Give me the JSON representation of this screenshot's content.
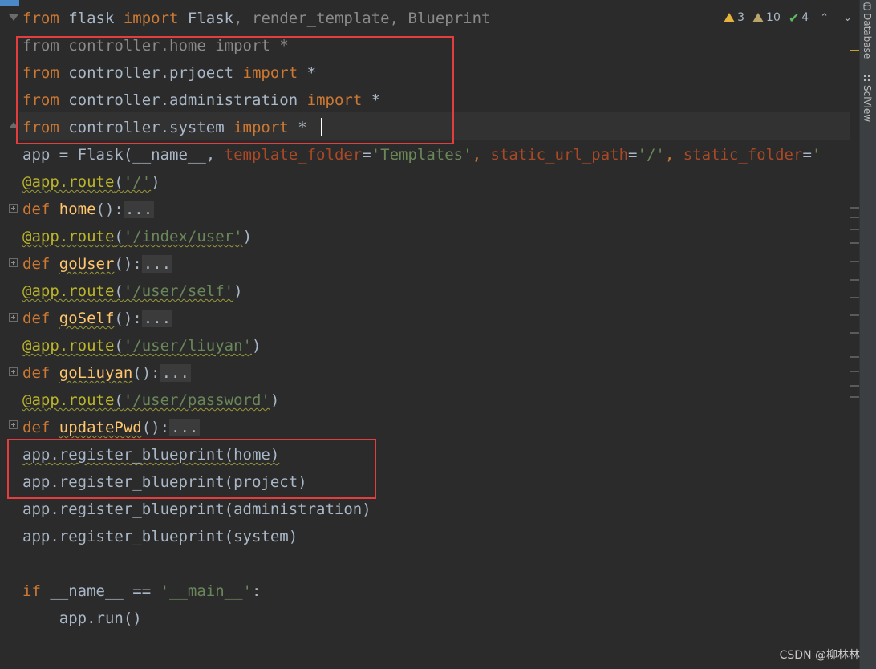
{
  "code": {
    "l1": {
      "kw1": "from",
      "mod": " flask ",
      "kw2": "import",
      "rest": " Flask",
      "c1": ", ",
      "d1": "render_template",
      "c2": ", ",
      "d2": "Blueprint"
    },
    "l2": {
      "kw1": "from",
      "mod": " controller.home ",
      "kw2": "import",
      "rest": " *"
    },
    "l3": {
      "kw1": "from",
      "mod": " controller.prjoect ",
      "kw2": "import",
      "rest": " *"
    },
    "l4": {
      "kw1": "from",
      "mod": " controller.administration ",
      "kw2": "import",
      "rest": " *"
    },
    "l5": {
      "kw1": "from",
      "mod": " controller.system ",
      "kw2": "import",
      "rest": " *"
    },
    "l6": {
      "a": "app = Flask(__name__, ",
      "p1": "template_folder",
      "e1": "=",
      "s1": "'Templates'",
      "c1": ", ",
      "p2": "static_url_path",
      "e2": "=",
      "s2": "'/'",
      "c2": ", ",
      "p3": "static_folder",
      "e3": "=",
      "s3": "'"
    },
    "l7": {
      "dec": "@app.route",
      "o": "(",
      "s": "'/'",
      "c": ")"
    },
    "l8": {
      "kw": "def ",
      "fn": "home",
      "o": "():",
      "fold": "..."
    },
    "l9": {
      "dec": "@app.route",
      "o": "(",
      "s": "'/index/user'",
      "c": ")"
    },
    "l10": {
      "kw": "def ",
      "fn": "goUser",
      "o": "():",
      "fold": "..."
    },
    "l11": {
      "dec": "@app.route",
      "o": "(",
      "s": "'/user/self'",
      "c": ")"
    },
    "l12": {
      "kw": "def ",
      "fn": "goSelf",
      "o": "():",
      "fold": "..."
    },
    "l13": {
      "dec": "@app.route",
      "o": "(",
      "s": "'/user/liuyan'",
      "c": ")"
    },
    "l14": {
      "kw": "def ",
      "fn": "goLiuyan",
      "o": "():",
      "fold": "..."
    },
    "l15": {
      "dec": "@app.route",
      "o": "(",
      "s": "'/user/password'",
      "c": ")"
    },
    "l16": {
      "kw": "def ",
      "fn": "updatePwd",
      "o": "():",
      "fold": "..."
    },
    "l17": "app.register_blueprint(home)",
    "l18": "app.register_blueprint(project)",
    "l19": "app.register_blueprint(administration)",
    "l20": "app.register_blueprint(system)",
    "l22": {
      "kw": "if",
      "mid": " __name__ == ",
      "s": "'__main__'",
      "c": ":"
    },
    "l23": "    app.run()"
  },
  "inspections": {
    "warnings": "3",
    "weak_warnings": "10",
    "ok": "4",
    "up": "⌃",
    "down": "⌄"
  },
  "side_tabs": {
    "database": "Database",
    "sciview": "SciView"
  },
  "watermark": "CSDN @柳林林",
  "colors": {
    "highlight_box": "#e43d3d",
    "keyword": "#cc7832",
    "string": "#6a8759",
    "decorator": "#bbb529",
    "function": "#ffc66d"
  }
}
